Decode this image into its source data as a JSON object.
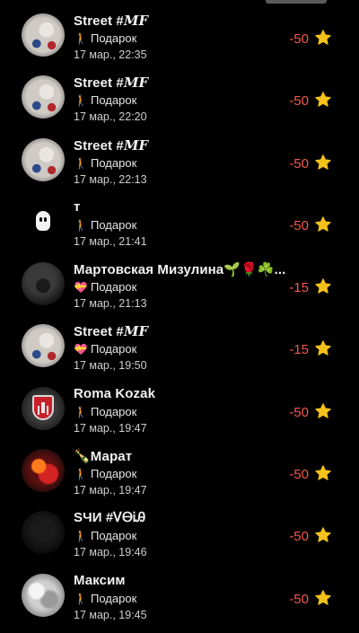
{
  "transactions": [
    {
      "avatar": "street-avatar",
      "name_main": "Street #",
      "name_suffix": "MF",
      "subtitle": "Подарок",
      "gift_icon": "🚶",
      "time": "17 мар., 22:35",
      "amount": "-50",
      "star_icon": "star-icon"
    },
    {
      "avatar": "street-avatar",
      "name_main": "Street #",
      "name_suffix": "MF",
      "subtitle": "Подарок",
      "gift_icon": "🚶",
      "time": "17 мар., 22:20",
      "amount": "-50",
      "star_icon": "star-icon"
    },
    {
      "avatar": "street-avatar",
      "name_main": "Street #",
      "name_suffix": "MF",
      "subtitle": "Подарок",
      "gift_icon": "🚶",
      "time": "17 мар., 22:13",
      "amount": "-50",
      "star_icon": "star-icon"
    },
    {
      "avatar": "ghost-avatar",
      "name_main": "т",
      "name_suffix": "",
      "subtitle": "Подарок",
      "gift_icon": "🚶",
      "time": "17 мар., 21:41",
      "amount": "-50",
      "star_icon": "star-icon"
    },
    {
      "avatar": "car-avatar",
      "name_main": "Мартовская Мизулина🌱🌹☘️...",
      "name_suffix": "",
      "subtitle": "Подарок",
      "gift_icon": "💝",
      "time": "17 мар., 21:13",
      "amount": "-15",
      "star_icon": "star-icon"
    },
    {
      "avatar": "street-avatar",
      "name_main": "Street #",
      "name_suffix": "MF",
      "subtitle": "Подарок",
      "gift_icon": "💝",
      "time": "17 мар., 19:50",
      "amount": "-15",
      "star_icon": "star-icon"
    },
    {
      "avatar": "shield-avatar",
      "name_main": "Roma Kozak",
      "name_suffix": "",
      "subtitle": "Подарок",
      "gift_icon": "🚶",
      "time": "17 мар., 19:47",
      "amount": "-50",
      "star_icon": "star-icon"
    },
    {
      "avatar": "fire-avatar",
      "name_main": "🍾Марат",
      "name_suffix": "",
      "subtitle": "Подарок",
      "gift_icon": "🚶",
      "time": "17 мар., 19:47",
      "amount": "-50",
      "star_icon": "star-icon"
    },
    {
      "avatar": "dark-avatar",
      "name_main": "ЅЧИ #ᏙᎾᎥᎯ",
      "name_suffix": "",
      "subtitle": "Подарок",
      "gift_icon": "🚶",
      "time": "17 мар., 19:46",
      "amount": "-50",
      "star_icon": "star-icon"
    },
    {
      "avatar": "silver-avatar",
      "name_main": "Максим",
      "name_suffix": "",
      "subtitle": "Подарок",
      "gift_icon": "🚶",
      "time": "17 мар., 19:45",
      "amount": "-50",
      "star_icon": "star-icon"
    }
  ],
  "colors": {
    "background": "#000000",
    "amount_negative": "#f25a4e",
    "star": "#f4c21b"
  }
}
